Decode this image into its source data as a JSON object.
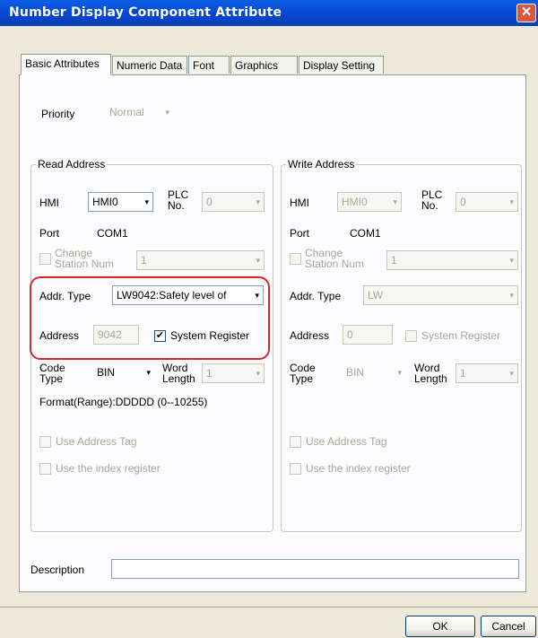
{
  "window": {
    "title": "Number Display Component Attribute",
    "close": "✕"
  },
  "tabs": [
    "Basic Attributes",
    "Numeric Data",
    "Font",
    "Graphics",
    "Display Setting"
  ],
  "priority": {
    "label": "Priority",
    "value": "Normal"
  },
  "read": {
    "legend": "Read Address",
    "hmi_label": "HMI",
    "hmi_value": "HMI0",
    "plc_label_1": "PLC",
    "plc_label_2": "No.",
    "plc_value": "0",
    "port_label": "Port",
    "port_value": "COM1",
    "change_1": "Change",
    "change_2": "Station Num",
    "change_value": "1",
    "addr_type_label": "Addr. Type",
    "addr_type_value": "LW9042:Safety level of",
    "address_label": "Address",
    "address_value": "9042",
    "sysreg_label": "System Register",
    "sysreg_checked": "✔",
    "code_1": "Code",
    "code_2": "Type",
    "code_value": "BIN",
    "word_1": "Word",
    "word_2": "Length",
    "word_value": "1",
    "format": "Format(Range):DDDDD (0--10255)",
    "use_tag": "Use Address Tag",
    "use_index": "Use the index register"
  },
  "write": {
    "legend": "Write Address",
    "hmi_label": "HMI",
    "hmi_value": "HMI0",
    "plc_label_1": "PLC",
    "plc_label_2": "No.",
    "plc_value": "0",
    "port_label": "Port",
    "port_value": "COM1",
    "change_1": "Change",
    "change_2": "Station Num",
    "change_value": "1",
    "addr_type_label": "Addr. Type",
    "addr_type_value": "LW",
    "address_label": "Address",
    "address_value": "0",
    "sysreg_label": "System Register",
    "code_1": "Code",
    "code_2": "Type",
    "code_value": "BIN",
    "word_1": "Word",
    "word_2": "Length",
    "word_value": "1",
    "use_tag": "Use Address Tag",
    "use_index": "Use the index register"
  },
  "description": {
    "label": "Description",
    "value": ""
  },
  "buttons": {
    "ok": "OK",
    "cancel": "Cancel"
  },
  "icons": {
    "dropdown": "▾"
  }
}
